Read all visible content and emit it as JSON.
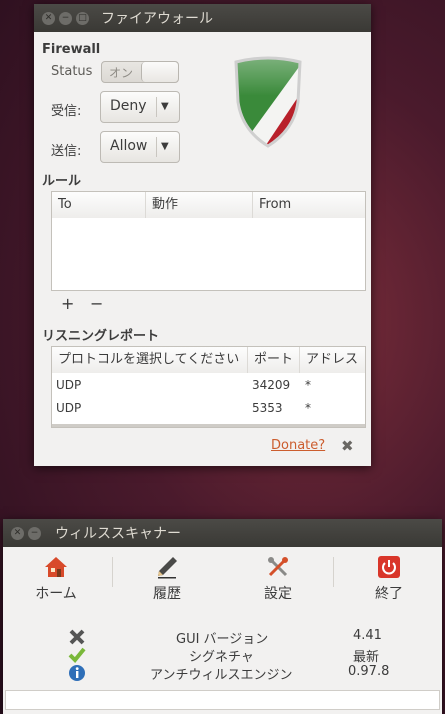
{
  "firewall_window": {
    "title": "ファイアウォール",
    "heading": "Firewall",
    "status_label": "Status",
    "status_value": "オン",
    "incoming_label": "受信:",
    "incoming_value": "Deny",
    "outgoing_label": "送信:",
    "outgoing_value": "Allow",
    "rules_heading": "ルール",
    "rules_columns": [
      "To",
      "動作",
      "From"
    ],
    "add_symbol": "+",
    "remove_symbol": "−",
    "listening_heading": "リスニングレポート",
    "listening_columns": [
      "プロトコルを選択してください",
      "ポート",
      "アドレス"
    ],
    "listening_rows": [
      {
        "protocol": "UDP",
        "port": "34209",
        "address": "*"
      },
      {
        "protocol": "UDP",
        "port": "5353",
        "address": "*"
      }
    ],
    "donate_label": "Donate?",
    "close_symbol": "✖",
    "shield_colors": {
      "green": "#3a8a3a",
      "white": "#f4f4f2",
      "red": "#b8202a"
    }
  },
  "scanner_window": {
    "title": "ウィルススキャナー",
    "toolbar": [
      {
        "label": "ホーム",
        "icon": "home-icon"
      },
      {
        "label": "履歴",
        "icon": "pencil-icon"
      },
      {
        "label": "設定",
        "icon": "tools-icon"
      },
      {
        "label": "終了",
        "icon": "power-icon"
      }
    ],
    "info_rows": [
      {
        "icon": "cross-icon",
        "name": "GUI バージョン",
        "value": "4.41"
      },
      {
        "icon": "check-icon",
        "name": "シグネチャ",
        "value": "最新"
      },
      {
        "icon": "info-icon",
        "name": "アンチウィルスエンジン",
        "value": "0.97.8"
      }
    ]
  }
}
